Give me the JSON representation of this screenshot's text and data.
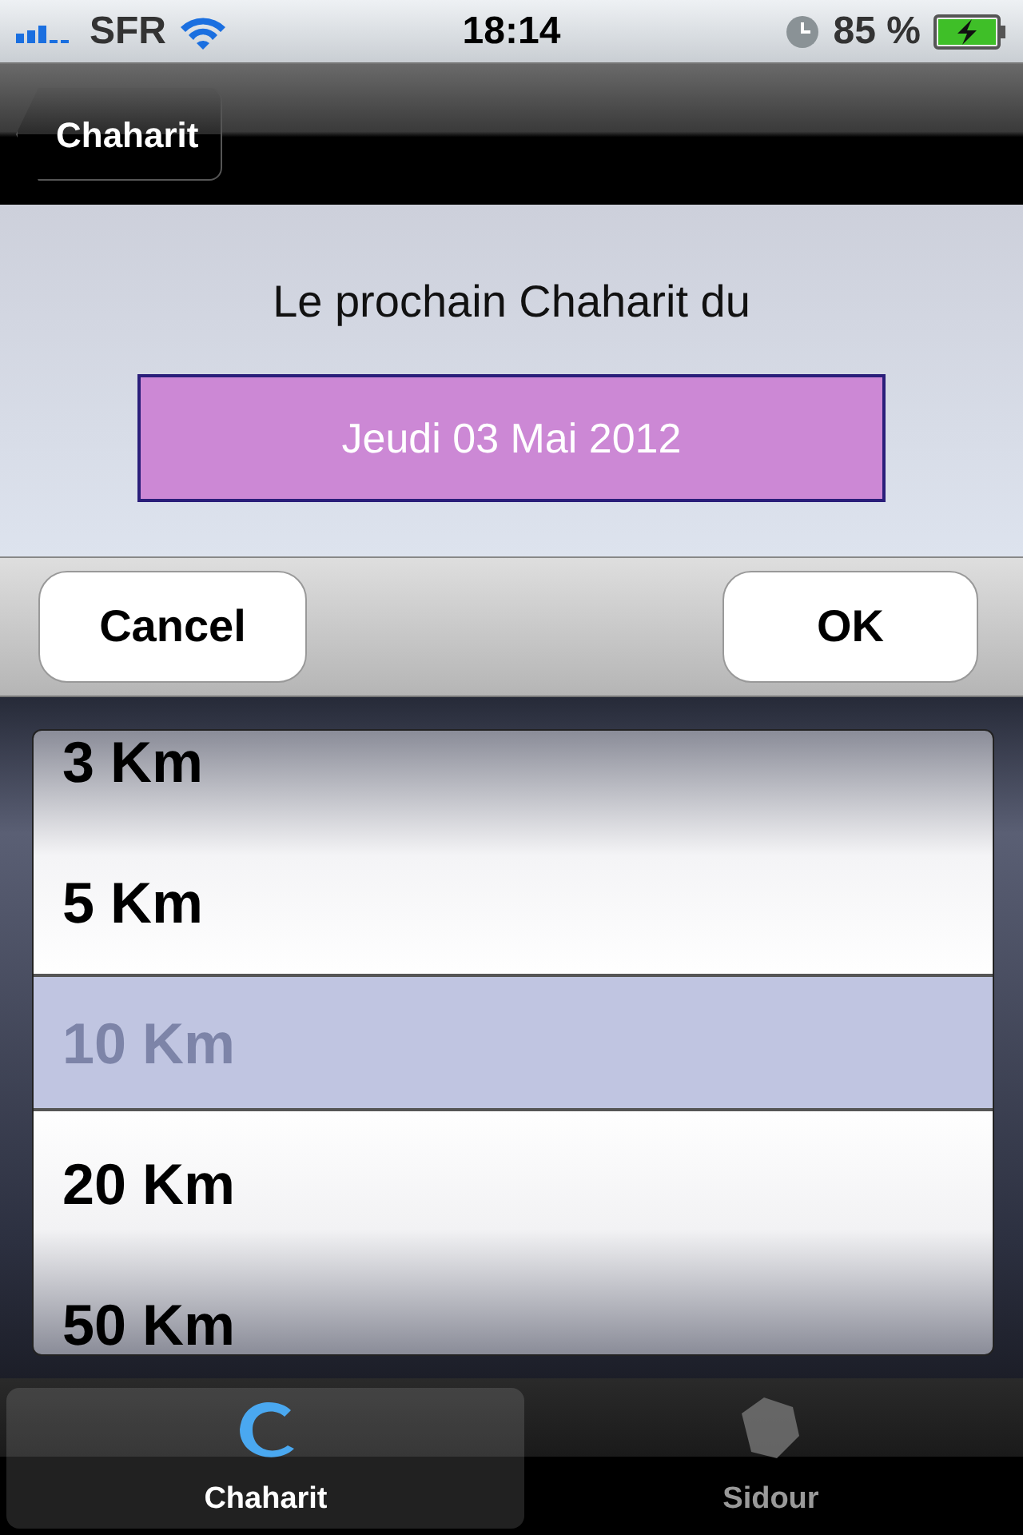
{
  "status_bar": {
    "carrier": "SFR",
    "time": "18:14",
    "battery": "85 %"
  },
  "nav_bar": {
    "back_button": "Chaharit"
  },
  "prompt": "Le prochain Chaharit du",
  "date": "Jeudi 03 Mai 2012",
  "toolbar": {
    "buttons": [
      "Cancel",
      "OK"
    ]
  },
  "picker": {
    "options": [
      {
        "label": "3 Km",
        "selected": false
      },
      {
        "label": "5 Km",
        "selected": false
      },
      {
        "label": "10 Km",
        "selected": true
      },
      {
        "label": "20 Km",
        "selected": false
      },
      {
        "label": "50 Km",
        "selected": false
      }
    ]
  },
  "tab_bar": {
    "tabs": [
      {
        "label": "Chaharit",
        "selected": true
      },
      {
        "label": "Sidour",
        "selected": false
      }
    ]
  }
}
